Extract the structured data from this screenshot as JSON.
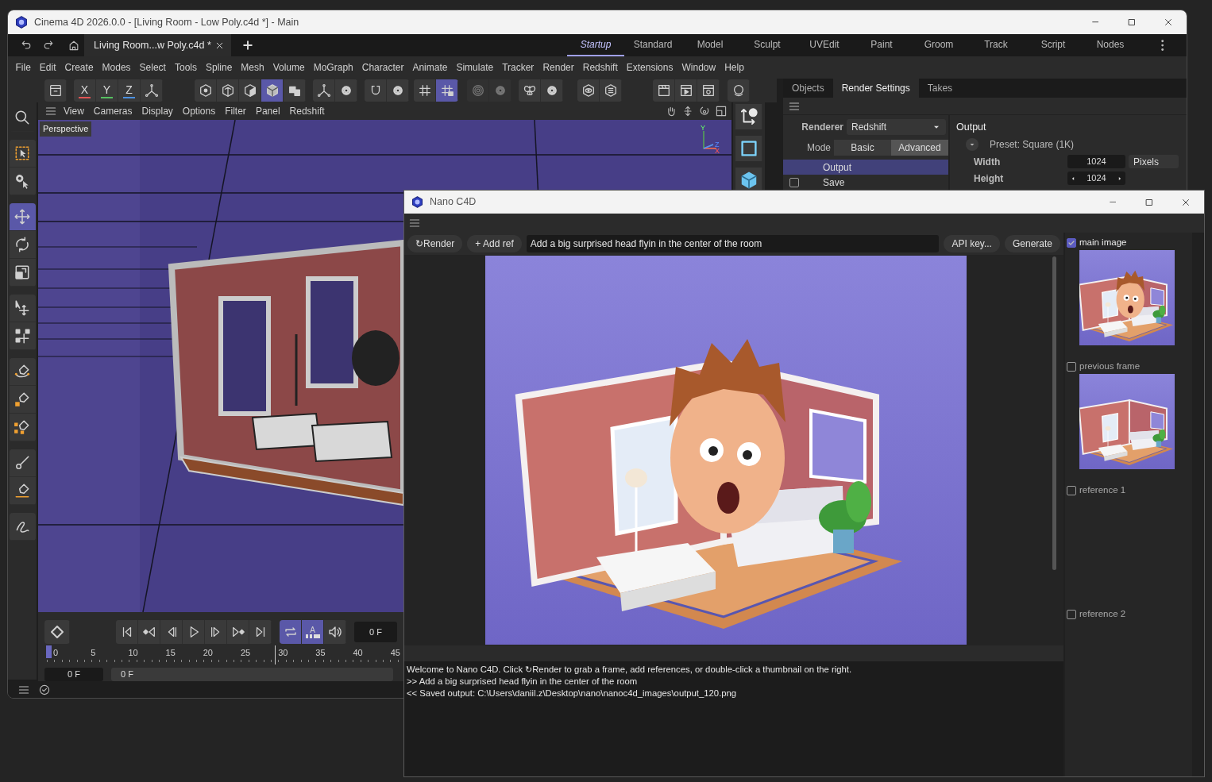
{
  "main_window": {
    "title": "Cinema 4D 2026.0.0 - [Living Room - Low Poly.c4d *] - Main"
  },
  "document_tabs": [
    {
      "label": "Living Room...w Poly.c4d *",
      "selected": true
    }
  ],
  "layouts": [
    {
      "label": "Startup",
      "selected": true
    },
    {
      "label": "Standard",
      "selected": false
    },
    {
      "label": "Model",
      "selected": false
    },
    {
      "label": "Sculpt",
      "selected": false
    },
    {
      "label": "UVEdit",
      "selected": false
    },
    {
      "label": "Paint",
      "selected": false
    },
    {
      "label": "Groom",
      "selected": false
    },
    {
      "label": "Track",
      "selected": false
    },
    {
      "label": "Script",
      "selected": false
    },
    {
      "label": "Nodes",
      "selected": false
    }
  ],
  "menu": [
    "File",
    "Edit",
    "Create",
    "Modes",
    "Select",
    "Tools",
    "Spline",
    "Mesh",
    "Volume",
    "MoGraph",
    "Character",
    "Animate",
    "Simulate",
    "Tracker",
    "Render",
    "Redshift",
    "Extensions",
    "Window",
    "Help"
  ],
  "toolbar": [
    {
      "disabled": false,
      "buttons": [
        {
          "active": false
        }
      ]
    },
    {
      "disabled": false,
      "buttons": [
        {
          "active": false,
          "label": "X",
          "color": "#e05555"
        },
        {
          "active": false,
          "label": "Y",
          "color": "#55c060"
        },
        {
          "active": false,
          "label": "Z",
          "color": "#4a90e0"
        },
        {
          "active": false
        }
      ]
    },
    {
      "disabled": false,
      "buttons": [
        {
          "active": false
        },
        {
          "active": false
        },
        {
          "active": false
        },
        {
          "active": true
        },
        {
          "active": false
        }
      ]
    },
    {
      "disabled": false,
      "buttons": [
        {
          "active": false
        },
        {
          "active": false
        }
      ]
    },
    {
      "disabled": false,
      "buttons": [
        {
          "active": false
        },
        {
          "active": false
        }
      ]
    },
    {
      "disabled": false,
      "buttons": [
        {
          "active": false
        },
        {
          "active": true
        }
      ]
    },
    {
      "disabled": true,
      "buttons": [
        {
          "active": false
        },
        {
          "active": false
        }
      ]
    },
    {
      "disabled": false,
      "buttons": [
        {
          "active": false
        },
        {
          "active": false
        }
      ]
    },
    {
      "disabled": false,
      "buttons": [
        {
          "active": false
        },
        {
          "active": false
        }
      ]
    },
    {
      "disabled": false,
      "buttons": [
        {
          "active": false
        },
        {
          "active": false
        },
        {
          "active": false
        }
      ]
    },
    {
      "disabled": false,
      "buttons": [
        {
          "active": false
        }
      ]
    }
  ],
  "tools": [
    [
      {
        "active": false
      }
    ],
    [
      {
        "active": false
      },
      {
        "active": false
      }
    ],
    [
      {
        "active": true
      },
      {
        "active": false
      },
      {
        "active": false
      }
    ],
    [
      {
        "active": false
      },
      {
        "active": false
      }
    ],
    [
      {
        "active": false
      },
      {
        "active": false
      },
      {
        "active": false
      }
    ],
    [
      {
        "active": false
      },
      {
        "active": false
      }
    ],
    [
      {
        "active": false
      }
    ]
  ],
  "viewport": {
    "menu": [
      "View",
      "Cameras",
      "Display",
      "Options",
      "Filter",
      "Panel",
      "Redshift"
    ],
    "camera_label": "Perspective",
    "axis_labels": [
      "Y",
      "Z",
      "X"
    ]
  },
  "timeline": {
    "modes": [
      {
        "active": true
      },
      {
        "active": true,
        "label": "A"
      },
      {
        "active": false
      }
    ],
    "current_frame": "0 F",
    "ruler": [
      "0",
      "5",
      "10",
      "15",
      "20",
      "25",
      "30",
      "35",
      "40",
      "45"
    ],
    "start_frame": "0 F",
    "range_start": "0 F"
  },
  "attribute_panel": {
    "tabs": [
      {
        "label": "Objects",
        "selected": false
      },
      {
        "label": "Render Settings",
        "selected": true
      },
      {
        "label": "Takes",
        "selected": false
      }
    ],
    "renderer_label": "Renderer",
    "renderer": "Redshift",
    "mode_label": "Mode",
    "modes": [
      {
        "label": "Basic",
        "selected": false
      },
      {
        "label": "Advanced",
        "selected": true
      }
    ],
    "items": [
      {
        "kind": "plain",
        "label": "Output",
        "selected": true
      },
      {
        "kind": "checkbox",
        "label": "Save",
        "selected": false,
        "checked": false
      }
    ],
    "section_title": "Output",
    "preset": "Preset: Square (1K)",
    "fields": [
      {
        "kind": "plain",
        "label": "Width",
        "value": "1024",
        "unit": "Pixels"
      },
      {
        "kind": "spinner",
        "label": "Height",
        "value": "1024"
      }
    ]
  },
  "nano": {
    "title": "Nano C4D",
    "render_button": "↻Render",
    "add_ref_button": "+ Add ref",
    "prompt": "Add a big surprised head flyin in the center of the room",
    "api_button": "API key...",
    "generate_button": "Generate",
    "slots": [
      {
        "label": "main image",
        "checked": true,
        "kind": "head_render"
      },
      {
        "label": "previous frame",
        "checked": false,
        "kind": "room_render"
      },
      {
        "label": "reference 1",
        "checked": false,
        "kind": "empty"
      },
      {
        "label": "reference 2",
        "checked": false,
        "kind": "empty"
      }
    ],
    "console": [
      "Welcome to Nano C4D. Click ↻Render to grab a frame, add references, or double-click a thumbnail on the right.",
      ">> Add a big surprised head flyin in the center of the room",
      "<< Saved output: C:\\Users\\daniil.z\\Desktop\\nano\\nanoc4d_images\\output_120.png"
    ]
  }
}
